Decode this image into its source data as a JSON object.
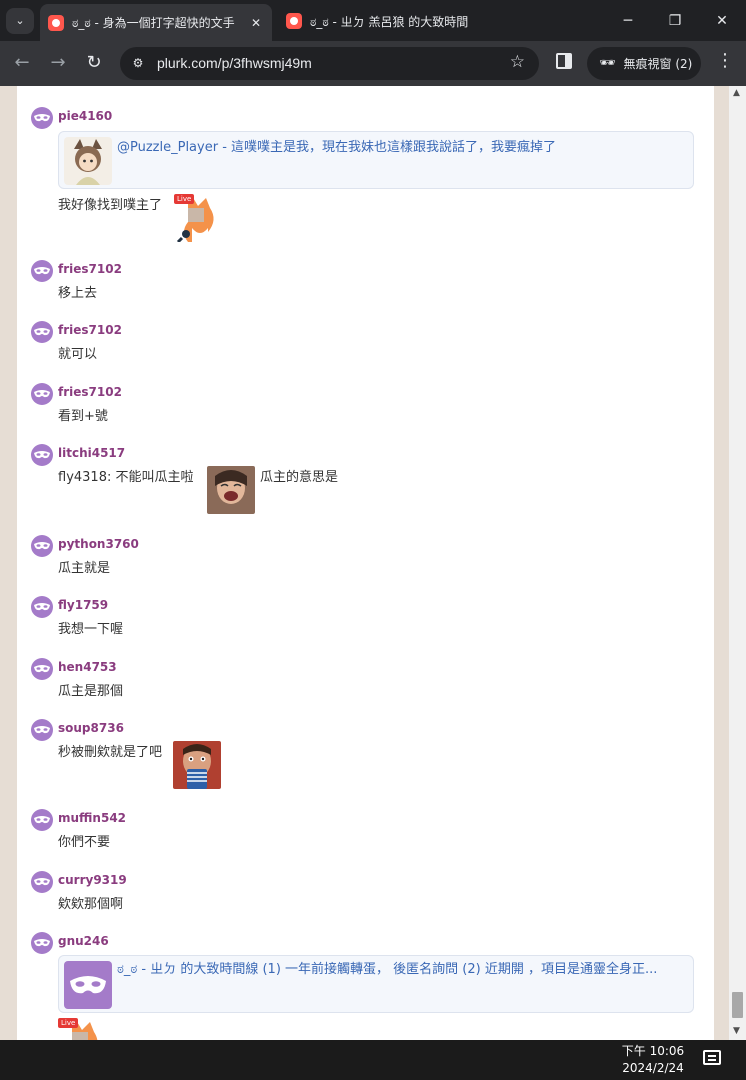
{
  "browser": {
    "tabs": [
      {
        "label": "ಠ_ಠ - 身為一個打字超快的文手",
        "active": true
      },
      {
        "label": "ಠ_ಠ - ㄓㄉ 羔呂狼 的大致時間",
        "active": false
      }
    ],
    "url": "plurk.com/p/3fhwsmj49m",
    "incognito_label": "無痕視窗 (2)"
  },
  "responses": [
    {
      "user": "pie4160",
      "quote": "@Puzzle_Player - 這噗噗主是我，現在我妹也這樣跟我說話了，我要瘋掉了",
      "text": "我好像找到噗主了",
      "emoji": "fox-live-emoji"
    },
    {
      "user": "fries7102",
      "text": "移上去"
    },
    {
      "user": "fries7102",
      "text": "就可以"
    },
    {
      "user": "fries7102",
      "text": "看到+號"
    },
    {
      "user": "litchi4517",
      "text": "fly4318: 不能叫瓜主啦",
      "text_after": "瓜主的意思是",
      "photo": "laughing-photo"
    },
    {
      "user": "python3760",
      "text": "瓜主就是"
    },
    {
      "user": "fly1759",
      "text": "我想一下喔"
    },
    {
      "user": "hen4753",
      "text": "瓜主是那個"
    },
    {
      "user": "soup8736",
      "text": "秒被刪欸就是了吧",
      "photo": "drinking-photo"
    },
    {
      "user": "muffin542",
      "text": "你們不要"
    },
    {
      "user": "curry9319",
      "text": "欸欸那個啊"
    },
    {
      "user": "gnu246",
      "quote": "ಠ_ಠ - ㄓㄉ 的大致時間線 (1) 一年前接觸轉蛋， 後匿名詢問 (2) 近期開 ，項目是通靈全身正...",
      "emoji": "fox-live-emoji"
    }
  ],
  "live_badge": "Live",
  "taskbar": {
    "time": "下午 10:06",
    "date": "2024/2/24"
  },
  "colors": {
    "username": "#8a3c7f",
    "quote_link": "#3a68b5",
    "mask_purple": "#a47bc9"
  }
}
